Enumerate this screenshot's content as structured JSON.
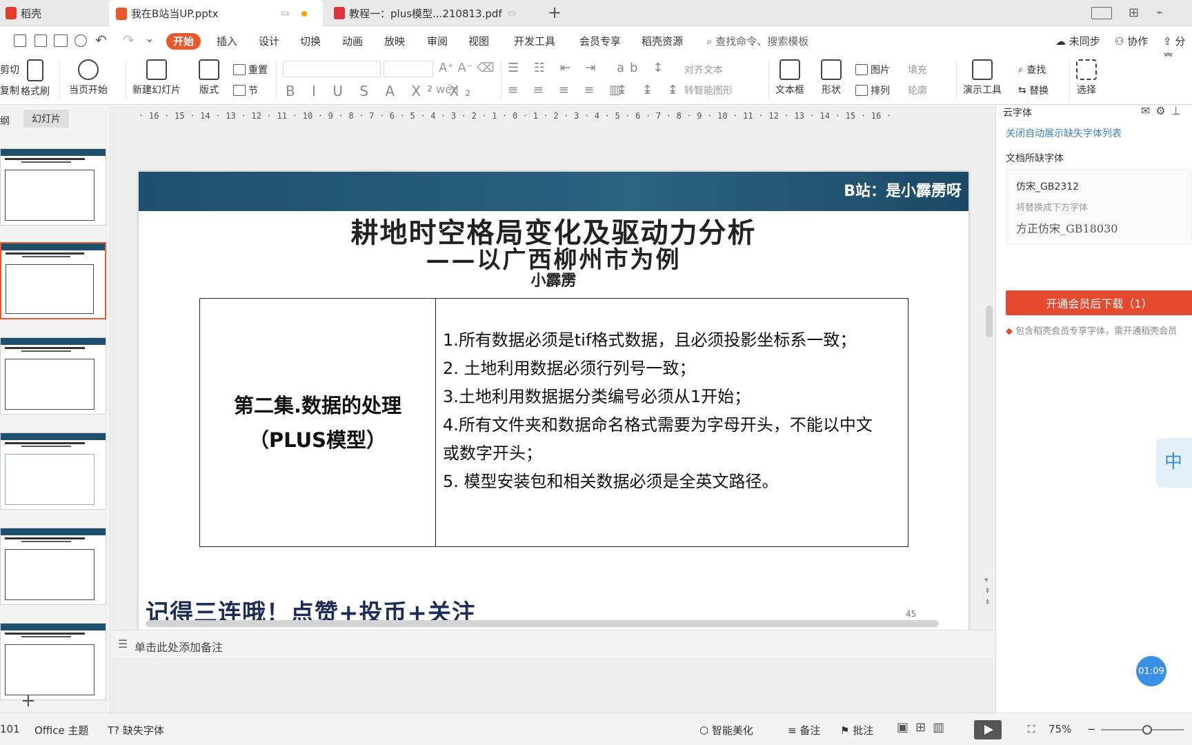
{
  "tabs": {
    "docer": "稻壳",
    "pptx": "我在B站当UP.pptx",
    "pdf": "教程一：plus模型...210813.pdf"
  },
  "menu": {
    "items": [
      "开始",
      "插入",
      "设计",
      "切换",
      "动画",
      "放映",
      "审阅",
      "视图",
      "开发工具",
      "会员专享",
      "稻壳资源"
    ],
    "search_placeholder": "查找命令、搜索模板",
    "unsync": "未同步",
    "collab": "协作",
    "share": "分享"
  },
  "ribbon": {
    "cut": "剪切",
    "copy": "复制",
    "format_painter": "格式刷",
    "play_current": "当页开始",
    "new_slide": "新建幻灯片",
    "layout": "版式",
    "reset": "重置",
    "section": "节",
    "align_text": "对齐文本",
    "smart_art": "转智能图形",
    "textbox": "文本框",
    "shapes": "形状",
    "picture": "图片",
    "arrange": "排列",
    "fill": "填充",
    "outline": "轮廓",
    "presenter": "演示工具",
    "find": "查找",
    "replace": "替换",
    "select": "选择"
  },
  "left_panel": {
    "outline_tab": "纲",
    "slides_tab": "幻灯片"
  },
  "ruler": "· 16 · 15 · 14 · 13 · 12 · 11 · 10 · 9 · 8 · 7 · 6 · 5 · 4 · 3 · 2 · 1 · 0 · 1 · 2 · 3 · 4 · 5 · 6 · 7 · 8 · 9 · 10 · 11 · 12 · 13 · 14 · 15 · 16 ·",
  "slide": {
    "banner": "B站：是小霹雳呀",
    "title": "耕地时空格局变化及驱动力分析",
    "subtitle": "——以广西柳州市为例",
    "author": "小霹雳",
    "left_cell_line1": "第二集.数据的处理",
    "left_cell_line2": "（PLUS模型）",
    "requirements": [
      "1.所有数据必须是tif格式数据，且必须投影坐标系一致；",
      "2. 土地利用数据必须行列号一致；",
      "3.土地利用数据据分类编号必须从1开始；",
      "4.所有文件夹和数据命名格式需要为字母开头，不能以中文",
      "或数字开头；",
      "5. 模型安装包和相关数据必须是全英文路径。"
    ],
    "footer": "记得三连哦！点赞+投币+关注",
    "page_number": "45"
  },
  "notes_placeholder": "单击此处添加备注",
  "right_panel": {
    "title": "云字体",
    "close_link": "关闭自动展示缺失字体列表",
    "missing_label": "文档所缺字体",
    "missing_font": "仿宋_GB2312",
    "replace_label": "将替换成下方字体",
    "replacement_font": "方正仿宋_GB18030",
    "vip_button": "开通会员后下载（1）",
    "vip_note": "包含稻壳会员专享字体，需开通稻壳会员",
    "ime": "中",
    "timer": "01:09"
  },
  "status": {
    "slide_index": "101",
    "theme": "Office 主题",
    "missing_fonts": "缺失字体",
    "beautify": "智能美化",
    "notes": "备注",
    "comments": "批注",
    "zoom": "75%"
  }
}
